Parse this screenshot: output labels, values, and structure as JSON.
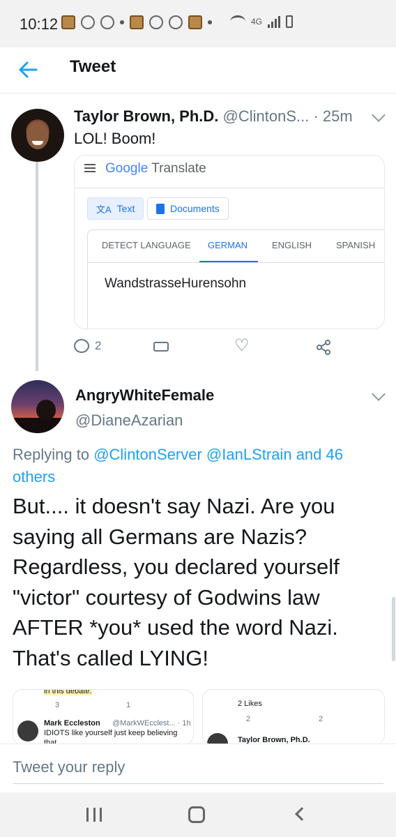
{
  "status_bar": {
    "time": "10:12",
    "network": "4G"
  },
  "header": {
    "title": "Tweet"
  },
  "tweet1": {
    "name": "Taylor Brown, Ph.D.",
    "handle": "@ClintonS...",
    "time": "· 25m",
    "text": "LOL! Boom!",
    "reply_count": "2",
    "image": {
      "app_brand": "Google",
      "app_name": "Translate",
      "mode_buttons": [
        "Text",
        "Documents"
      ],
      "tabs": [
        "DETECT LANGUAGE",
        "GERMAN",
        "ENGLISH",
        "SPANISH"
      ],
      "selected_tab": "GERMAN",
      "source_text": "WandstrasseHurensohn"
    }
  },
  "tweet2": {
    "name": "AngryWhiteFemale",
    "handle": "@DianeAzarian",
    "replying_prefix": "Replying to",
    "replying_handles": "@ClintonServer @IanLStrain",
    "replying_suffix": "and 46 others",
    "text": "But.... it doesn't say Nazi. Are you saying all Germans are Nazis? Regardless, you declared yourself \"victor\" courtesy of Godwins law AFTER *you* used the word Nazi. That's called LYING!",
    "thumb_left": {
      "top_text": "in this debate.",
      "counts": [
        "3",
        "1"
      ],
      "author": "Mark Eccleston",
      "author_handle": "@MarkWEcclest... · 1h",
      "snippet": "IDIOTS like yourself just keep believing",
      "snippet2": "that..."
    },
    "thumb_right": {
      "likes": "2 Likes",
      "counts": [
        "2",
        "2"
      ],
      "author": "Taylor Brown, Ph.D."
    }
  },
  "reply_bar": {
    "placeholder": "Tweet your reply"
  },
  "colors": {
    "link": "#1da1f2",
    "muted": "#657786",
    "text": "#14171a"
  }
}
